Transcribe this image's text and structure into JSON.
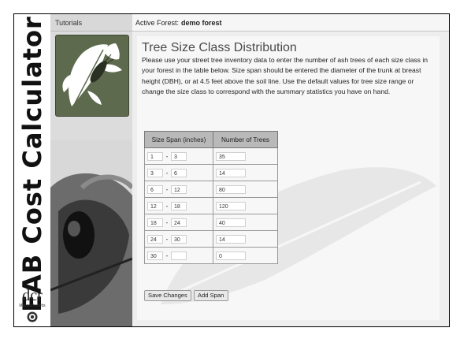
{
  "slide": {
    "vertical_title": "EAB Cost Calculator",
    "logo_text": "dcr",
    "logo_sub": "Massachusetts"
  },
  "nav": {
    "tab_label": "Tutorials"
  },
  "header": {
    "active_forest_label": "Active Forest:",
    "active_forest_name": "demo forest"
  },
  "page": {
    "title": "Tree Size Class Distribution",
    "intro": "Please use your street tree inventory data to enter the number of ash trees of each size class in your forest in the table below. Size span should be entered the diameter of the trunk at breast height (DBH), or at 4.5 feet above the soil line. Use the default values for tree size range or change the size class to correspond with the summary statistics you have on hand."
  },
  "table": {
    "col_span": "Size Span (inches)",
    "col_count": "Number of Trees",
    "rows": [
      {
        "from": "1",
        "to": "3",
        "count": "35"
      },
      {
        "from": "3",
        "to": "6",
        "count": "14"
      },
      {
        "from": "6",
        "to": "12",
        "count": "80"
      },
      {
        "from": "12",
        "to": "18",
        "count": "120"
      },
      {
        "from": "18",
        "to": "24",
        "count": "40"
      },
      {
        "from": "24",
        "to": "30",
        "count": "14"
      },
      {
        "from": "30",
        "to": "",
        "count": "0"
      }
    ]
  },
  "buttons": {
    "save": "Save Changes",
    "add": "Add Span"
  },
  "colors": {
    "logo_bg": "#5d6a4e",
    "header_bg": "#b9b9b9"
  }
}
